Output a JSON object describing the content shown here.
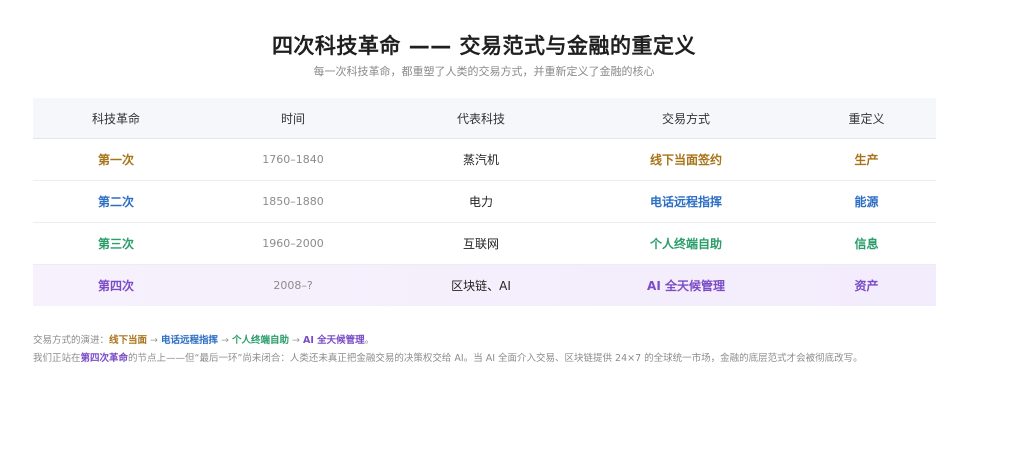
{
  "header": {
    "title": "四次科技革命 —— 交易范式与金融的重定义",
    "subtitle": "每一次科技革命，都重塑了人类的交易方式，并重新定义了金融的核心"
  },
  "colors": {
    "first": "#a8741a",
    "second": "#2d6fc4",
    "third": "#2a9d6a",
    "fourth": "#7b4cc6",
    "highlight_bg": "#f5effc"
  },
  "table": {
    "columns": [
      "科技革命",
      "时间",
      "代表科技",
      "交易方式",
      "重定义"
    ],
    "rows": [
      {
        "revolution": "第一次",
        "period": "1760–1840",
        "technology": "蒸汽机",
        "trade_mode": "线下当面签约",
        "redefined": "生产"
      },
      {
        "revolution": "第二次",
        "period": "1850–1880",
        "technology": "电力",
        "trade_mode": "电话远程指挥",
        "redefined": "能源"
      },
      {
        "revolution": "第三次",
        "period": "1960–2000",
        "technology": "互联网",
        "trade_mode": "个人终端自助",
        "redefined": "信息"
      },
      {
        "revolution": "第四次",
        "period": "2008–?",
        "technology": "区块链、AI",
        "trade_mode": "AI 全天候管理",
        "redefined": "资产"
      }
    ]
  },
  "notes": {
    "evolution_prefix": "交易方式的演进：",
    "evolution_steps": [
      "线下当面",
      "电话远程指挥",
      "个人终端自助",
      "AI 全天候管理"
    ],
    "evolution_suffix": "。",
    "arrow": "→",
    "stance_prefix": "我们正站在",
    "stance_highlight": "第四次革命",
    "stance_rest": "的节点上——但“最后一环”尚未闭合：人类还未真正把金融交易的决策权交给 AI。当 AI 全面介入交易、区块链提供 24×7 的全球统一市场，金融的底层范式才会被彻底改写。"
  }
}
